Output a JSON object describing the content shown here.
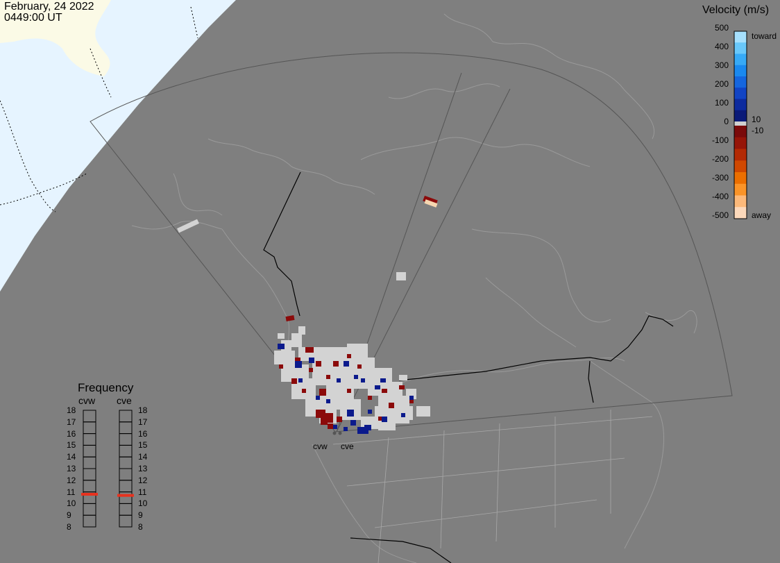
{
  "header": {
    "date": "February, 24 2022",
    "time": "0449:00 UT"
  },
  "colorbar": {
    "title": "Velocity (m/s)",
    "ticks": [
      "500",
      "400",
      "300",
      "200",
      "100",
      "0",
      "-100",
      "-200",
      "-300",
      "-400",
      "-500"
    ],
    "ticks_values": [
      500,
      400,
      300,
      200,
      100,
      0,
      -100,
      -200,
      -300,
      -400,
      -500
    ],
    "positive_label": "toward",
    "negative_label": "away",
    "threshold_pos": "10",
    "threshold_neg": "-10",
    "colors_toward": [
      "#0a1a78",
      "#0d2b9e",
      "#1144c4",
      "#1566de",
      "#1a89ef",
      "#37aaf6",
      "#69c8fa",
      "#a6e0fd"
    ],
    "colors_away": [
      "#7a0a0a",
      "#961508",
      "#b32a04",
      "#d04800",
      "#ec6f00",
      "#fb9428",
      "#fdb97a",
      "#fdd9bb"
    ],
    "ground_scatter_color": "#d0d0d0"
  },
  "frequency": {
    "title": "Frequency",
    "radars": [
      {
        "name": "cvw",
        "value": 10.8
      },
      {
        "name": "cve",
        "value": 10.7
      }
    ],
    "ticks": [
      "18",
      "17",
      "16",
      "15",
      "14",
      "13",
      "12",
      "11",
      "10",
      "9",
      "8"
    ],
    "marker_color": "#e8321e"
  },
  "radars": [
    {
      "name": "cvw"
    },
    {
      "name": "cve"
    }
  ],
  "map": {
    "ocean_color": "#e6f4ff",
    "ice_color": "#fbfae6",
    "land_color": "#7f7f7f",
    "coastline_color": "#999999",
    "border_color": "#000000"
  }
}
